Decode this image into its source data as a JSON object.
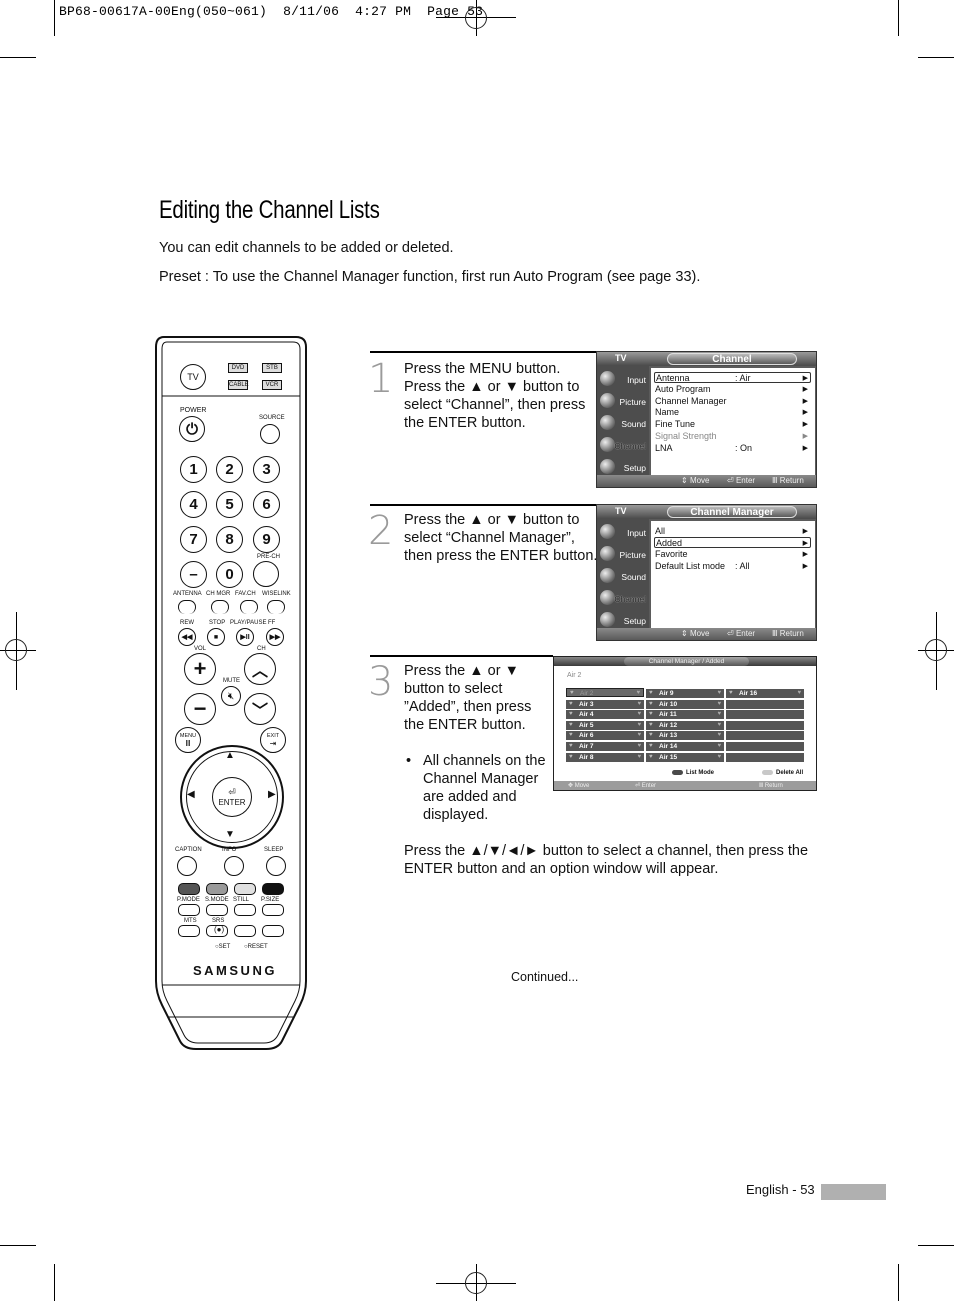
{
  "print_slug": {
    "file": "BP68-00617A-00Eng(050~061)",
    "date": "8/11/06",
    "time": "4:27 PM",
    "page_label": "Page 53"
  },
  "page": {
    "title": "Editing the Channel Lists",
    "intro": "You can edit channels to be added or deleted.",
    "preset": "Preset : To use the Channel Manager function, first run Auto Program (see page 33).",
    "continued": "Continued...",
    "footer": "English - 53"
  },
  "steps": [
    {
      "number": "1",
      "lines": [
        "Press the MENU button.",
        "Press the ▲ or ▼ button to",
        "select “Channel”, then press",
        "the ENTER button."
      ]
    },
    {
      "number": "2",
      "lines": [
        "Press the ▲ or ▼ button to",
        "select “Channel Manager”,",
        "then press the ENTER button."
      ]
    },
    {
      "number": "3",
      "lines": [
        "Press the ▲ or ▼",
        "button to select",
        "”Added”, then press",
        "the ENTER button."
      ],
      "bullet": [
        "All channels on the",
        "Channel Manager",
        "are added and",
        "displayed."
      ],
      "after": [
        "Press the ▲/▼/◄/► button to select a channel, then press the",
        "ENTER button and an option window will appear."
      ]
    }
  ],
  "osd_common": {
    "tv_label": "TV",
    "sidebar": [
      "Input",
      "Picture",
      "Sound",
      "Channel",
      "Setup"
    ],
    "active_sidebar": "Channel",
    "hints": {
      "move": "Move",
      "enter": "Enter",
      "return": "Return"
    }
  },
  "osd_channel": {
    "title": "Channel",
    "rows": [
      {
        "label": "Antenna",
        "value": ": Air",
        "selected": true
      },
      {
        "label": "Auto Program",
        "value": ""
      },
      {
        "label": "Channel Manager",
        "value": ""
      },
      {
        "label": "Name",
        "value": ""
      },
      {
        "label": "Fine Tune",
        "value": ""
      },
      {
        "label": "Signal Strength",
        "value": "",
        "dim": true
      },
      {
        "label": "LNA",
        "value": ": On"
      }
    ]
  },
  "osd_channel_manager": {
    "title": "Channel Manager",
    "rows": [
      {
        "label": "All",
        "value": ""
      },
      {
        "label": "Added",
        "value": "",
        "selected": true
      },
      {
        "label": "Favorite",
        "value": ""
      },
      {
        "label": "Default List mode",
        "value": ": All"
      }
    ]
  },
  "osd_added": {
    "title": "Channel Manager / Added",
    "current": "Air 2",
    "columns": [
      [
        "Air 2",
        "Air 3",
        "Air 4",
        "Air 5",
        "Air 6",
        "Air 7",
        "Air 8"
      ],
      [
        "Air 9",
        "Air 10",
        "Air 11",
        "Air 12",
        "Air 13",
        "Air 14",
        "Air 15"
      ],
      [
        "Air 16",
        "",
        "",
        "",
        "",
        "",
        ""
      ]
    ],
    "selected": "Air 2",
    "legend": {
      "list_mode": "List Mode",
      "delete_all": "Delete All"
    },
    "colors": {
      "list_mode": "#4a4a4a",
      "delete_all": "#c8c8c8"
    },
    "hints": {
      "move": "Move",
      "enter": "Enter",
      "return": "Return"
    }
  },
  "remote": {
    "mode_buttons": [
      "TV",
      "DVD",
      "STB",
      "CABLE",
      "VCR"
    ],
    "power": "POWER",
    "source": "SOURCE",
    "digits": [
      "1",
      "2",
      "3",
      "4",
      "5",
      "6",
      "7",
      "8",
      "9",
      "–",
      "0",
      ""
    ],
    "pre_ch": "PRE-CH",
    "row_labels": [
      "ANTENNA",
      "CH MGR",
      "FAV.CH",
      "WISELINK"
    ],
    "transport_labels": [
      "REW",
      "STOP",
      "PLAY/PAUSE",
      "FF"
    ],
    "transport_icons": [
      "◀◀",
      "■",
      "▶II",
      "▶▶"
    ],
    "vol": "VOL",
    "ch": "CH",
    "mute": "MUTE",
    "menu": "MENU",
    "exit": "EXIT",
    "enter": "ENTER",
    "func_labels": [
      "CAPTION",
      "INFO",
      "SLEEP"
    ],
    "color_labels": [
      "P.MODE",
      "S.MODE",
      "STILL",
      "P.SIZE"
    ],
    "color_fills": [
      "#555555",
      "#9a9a9a",
      "#e0e0e0",
      "#111111"
    ],
    "bottom_labels": [
      "MTS",
      "SRS"
    ],
    "set": "SET",
    "reset": "RESET",
    "brand": "SAMSUNG"
  }
}
